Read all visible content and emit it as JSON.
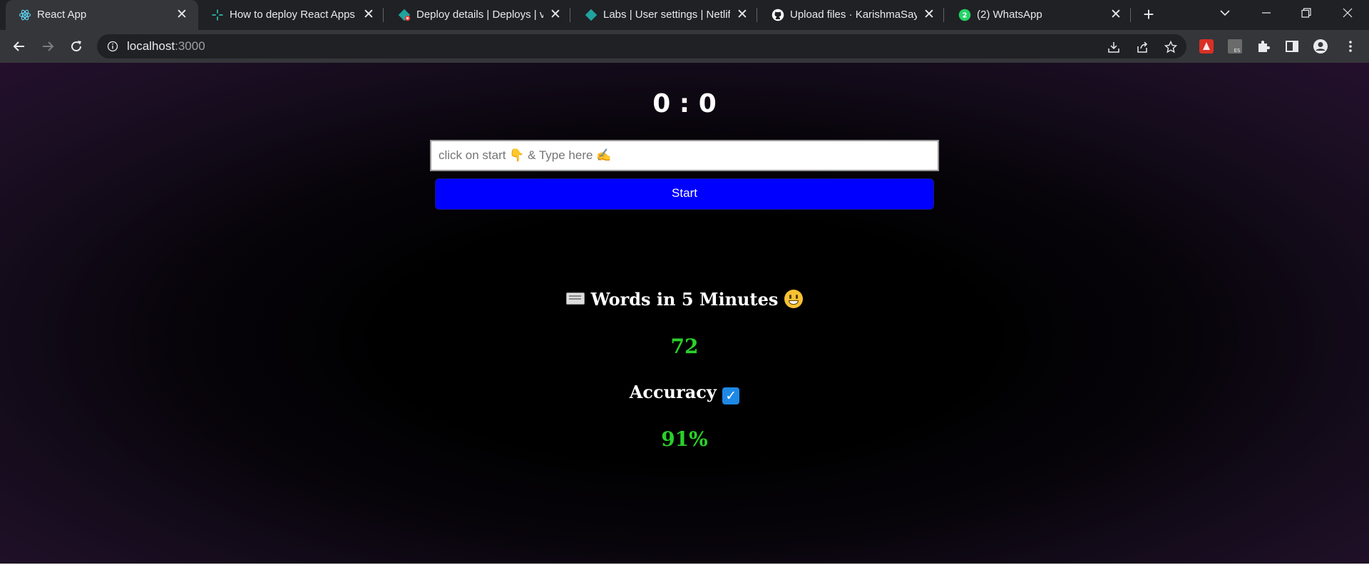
{
  "browser": {
    "tabs": [
      {
        "title": "React App",
        "active": true,
        "favicon": "react-icon"
      },
      {
        "title": "How to deploy React Apps",
        "favicon": "dev-icon"
      },
      {
        "title": "Deploy details | Deploys | v",
        "favicon": "netlify-error-icon"
      },
      {
        "title": "Labs | User settings | Netlify",
        "favicon": "netlify-icon"
      },
      {
        "title": "Upload files · KarishmaSayy",
        "favicon": "github-icon"
      },
      {
        "title": "(2) WhatsApp",
        "favicon": "whatsapp-icon",
        "badge": "2"
      }
    ],
    "address": {
      "host": "localhost",
      "port": ":3000"
    }
  },
  "app": {
    "timer": "0 : 0",
    "input_placeholder": "click on start 👇 & Type here ✍",
    "start_label": "Start",
    "words_label": "Words in 5 Minutes",
    "words_value": "72",
    "accuracy_label": "Accuracy",
    "accuracy_value": "91%"
  },
  "colors": {
    "start_button": "#0000ff",
    "stat_value": "#2ad12a",
    "chrome_tabbar": "#202124",
    "chrome_toolbar": "#35363a"
  }
}
